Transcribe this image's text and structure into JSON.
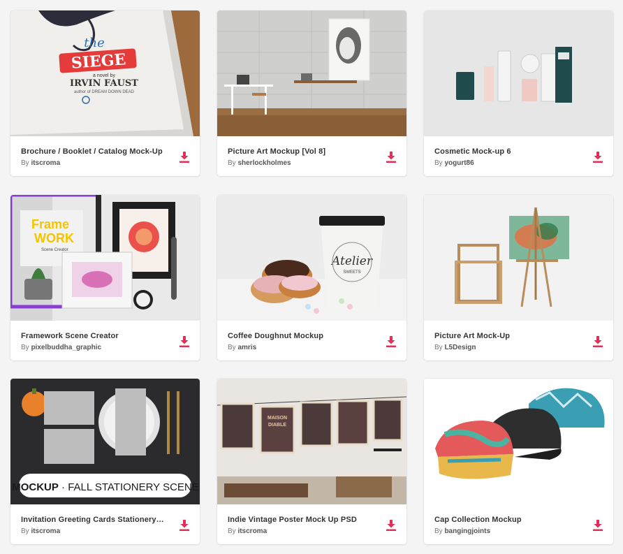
{
  "colors": {
    "accent": "#e0305a",
    "background": "#f4f4f4",
    "card": "#ffffff"
  },
  "download_icon": "download-icon",
  "cards": [
    {
      "title": "Brochure / Booklet / Catalog Mock-Up",
      "by": "By",
      "author": "itscroma",
      "thumb_text": [
        "the",
        "SIEGE",
        "a novel by",
        "IRVIN FAUST",
        "author of DREAM DOWN DEAD"
      ]
    },
    {
      "title": "Picture Art Mockup [Vol 8]",
      "by": "By",
      "author": "sherlockholmes"
    },
    {
      "title": "Cosmetic Mock-up 6",
      "by": "By",
      "author": "yogurt86"
    },
    {
      "title": "Framework Scene Creator",
      "by": "By",
      "author": "pixelbuddha_graphic",
      "thumb_text": [
        "Frame",
        "WORK",
        "Scene Creator"
      ]
    },
    {
      "title": "Coffee Doughnut Mockup",
      "by": "By",
      "author": "amris",
      "thumb_text": [
        "Atelier",
        "SWEETS"
      ]
    },
    {
      "title": "Picture Art Mock-Up",
      "by": "By",
      "author": "L5Design"
    },
    {
      "title": "Invitation Greeting Cards Stationery Scene",
      "by": "By",
      "author": "itscroma",
      "thumb_text": [
        "MOCKUP",
        "· FALL STATIONERY SCENE"
      ]
    },
    {
      "title": "Indie Vintage Poster Mock Up PSD",
      "by": "By",
      "author": "itscroma",
      "thumb_text": [
        "MAISON",
        "DIABLE"
      ]
    },
    {
      "title": "Cap Collection Mockup",
      "by": "By",
      "author": "bangingjoints"
    }
  ]
}
